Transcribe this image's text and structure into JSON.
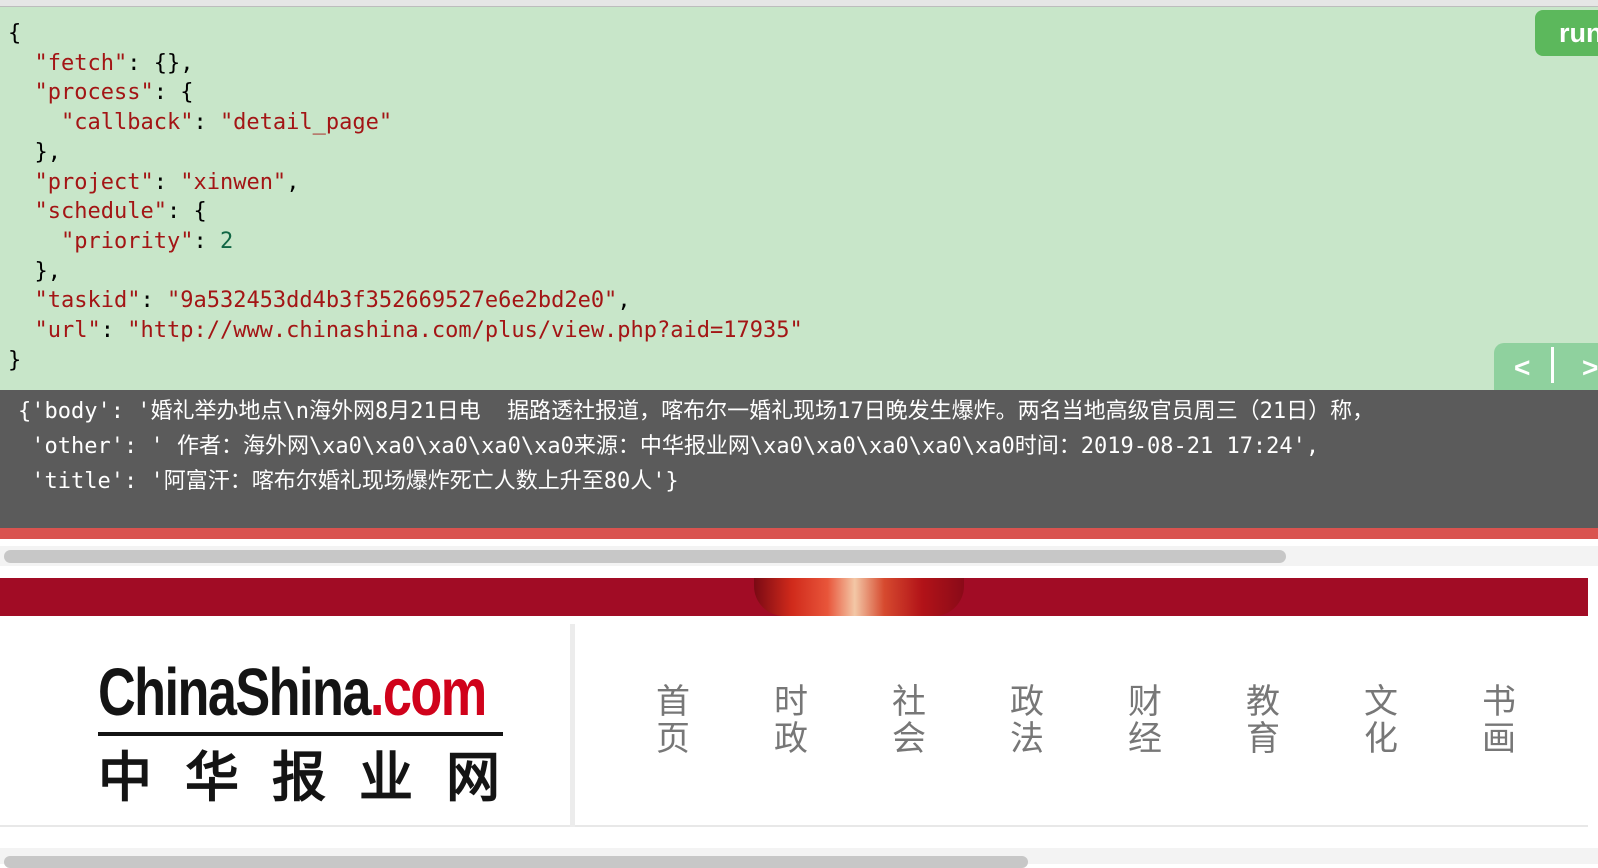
{
  "editor": {
    "lines": [
      "{",
      "  \"fetch\": {},",
      "  \"process\": {",
      "    \"callback\": \"detail_page\"",
      "  },",
      "  \"project\": \"xinwen\",",
      "  \"schedule\": {",
      "    \"priority\": 2",
      "  },",
      "  \"taskid\": \"9a532453dd4b3f352669527e6e2bd2e0\",",
      "  \"url\": \"http://www.chinashina.com/plus/view.php?aid=17935\"",
      "}"
    ],
    "run_label": "run",
    "prev_label": "<",
    "next_label": ">"
  },
  "result": {
    "lines": [
      "{'body': '婚礼举办地点\\n海外网8月21日电  据路透社报道，喀布尔一婚礼现场17日晚发生爆炸。两名当地高级官员周三（21日）称，",
      " 'other': ' 作者：海外网\\xa0\\xa0\\xa0\\xa0\\xa0来源：中华报业网\\xa0\\xa0\\xa0\\xa0\\xa0时间：2019-08-21 17:24',",
      " 'title': '阿富汗：喀布尔婚礼现场爆炸死亡人数上升至80人'}"
    ]
  },
  "site": {
    "logo_en_black": "ChinaShina",
    "logo_en_red": ".com",
    "logo_cn": "中华报业网",
    "nav": [
      {
        "line1": "首",
        "line2": "页"
      },
      {
        "line1": "时",
        "line2": "政"
      },
      {
        "line1": "社",
        "line2": "会"
      },
      {
        "line1": "政",
        "line2": "法"
      },
      {
        "line1": "财",
        "line2": "经"
      },
      {
        "line1": "教",
        "line2": "育"
      },
      {
        "line1": "文",
        "line2": "化"
      },
      {
        "line1": "书",
        "line2": "画"
      }
    ]
  },
  "colors": {
    "editor_bg": "#c8e6c9",
    "run_button": "#5cb85c",
    "result_bg": "#5b5b5b",
    "error_bar": "#d9534f",
    "banner": "#a10c25"
  }
}
